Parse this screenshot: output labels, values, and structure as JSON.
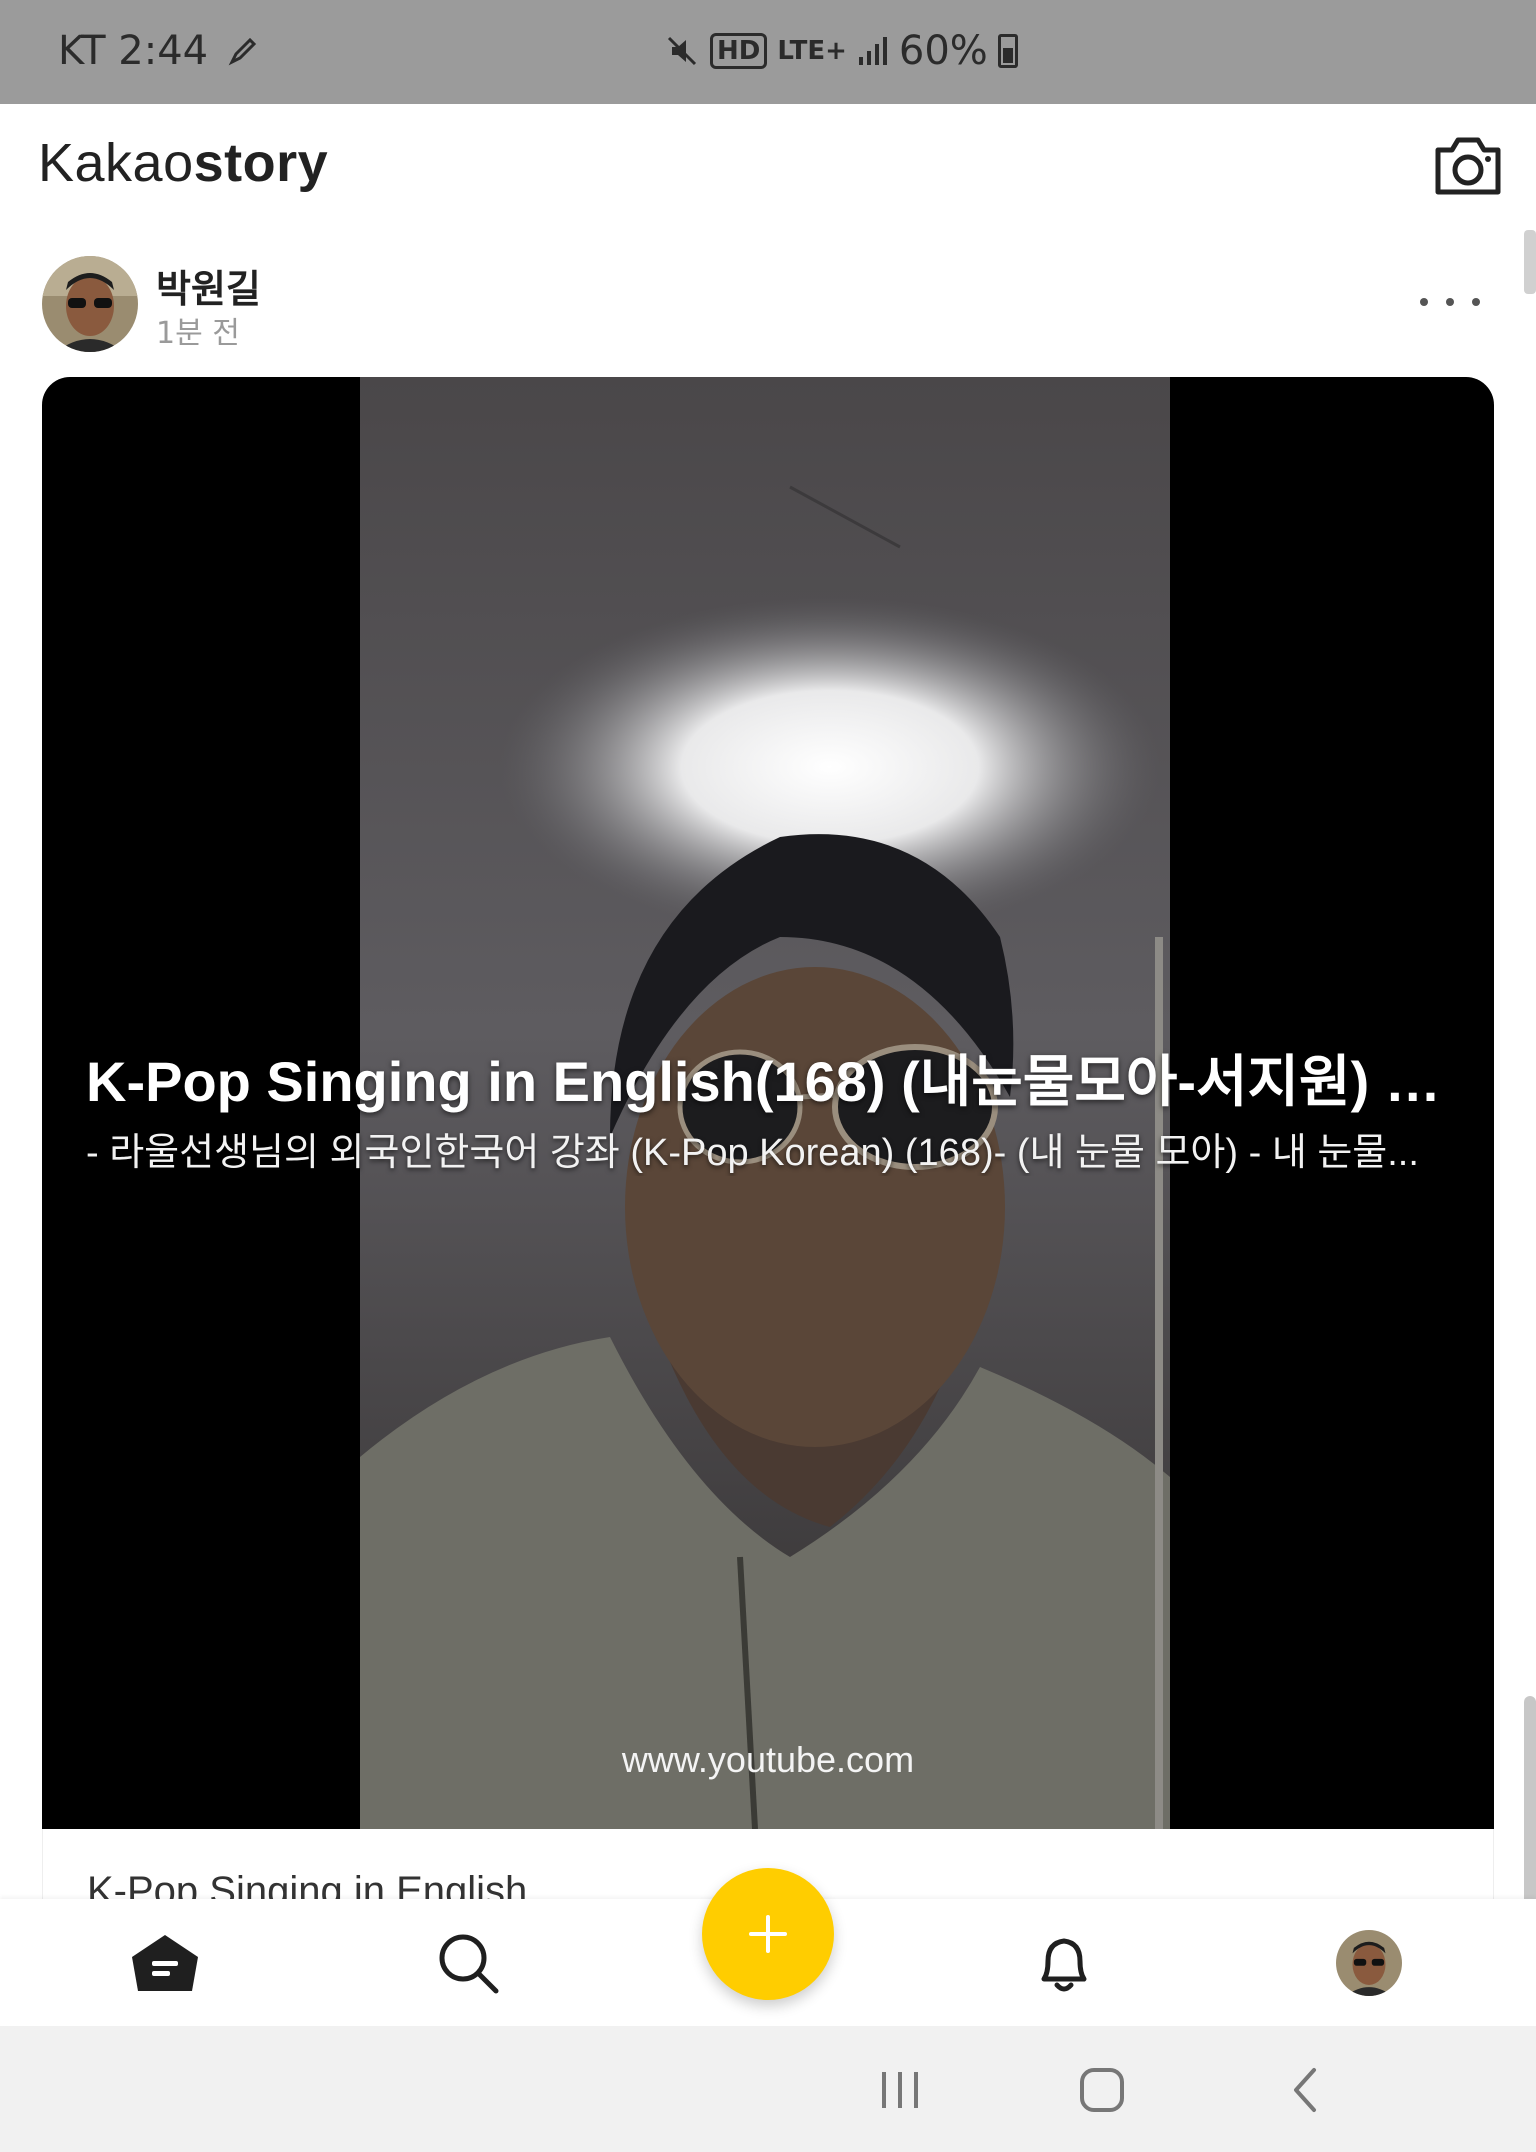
{
  "status_bar": {
    "carrier_time": "KT 2:44",
    "network_hd": "HD",
    "network_lte": "LTE+",
    "battery": "60%"
  },
  "app": {
    "logo_light": "Kakao",
    "logo_bold": "story"
  },
  "post": {
    "author": "박원길",
    "time_ago": "1분 전",
    "card": {
      "title": "K-Pop Singing in English(168) (내눈물모아-서지원) G...",
      "description": "- 라울선생님의 외국인한국어 강좌 (K-Pop Korean) (168)- (내 눈물 모아)  - 내 눈물...",
      "domain": "www.youtube.com"
    },
    "caption_partial": "K-Pop Singing in English"
  },
  "icons": {
    "camera": "camera-icon",
    "more": "more-icon",
    "home": "home-icon",
    "search": "search-icon",
    "add": "plus-icon",
    "notifications": "bell-icon",
    "recent_apps": "recent-apps-icon",
    "home_system": "system-home-icon",
    "back": "back-icon"
  },
  "colors": {
    "accent": "#ffcd00",
    "status_bar": "#9b9b9b",
    "card_bg": "#000000"
  }
}
